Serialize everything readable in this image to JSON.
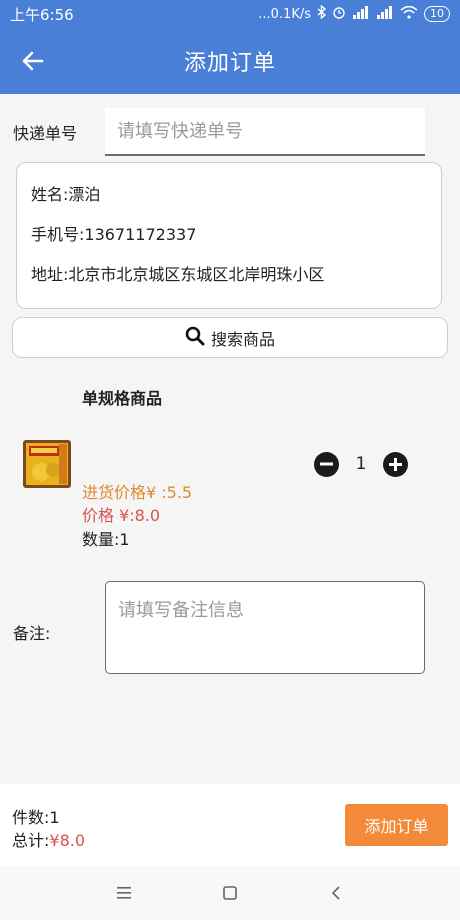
{
  "status_bar": {
    "time": "上午6:56",
    "network_speed": "...0.1K/s",
    "battery": "10"
  },
  "app_bar": {
    "title": "添加订单",
    "back_icon": "arrow-left-icon"
  },
  "express": {
    "label": "快递单号",
    "placeholder": "请填写快递单号",
    "value": ""
  },
  "address_card": {
    "name": "姓名:漂泊",
    "phone": "手机号:13671172337",
    "address": "地址:北京市北京城区东城区北岸明珠小区"
  },
  "search_button": {
    "label": "搜索商品",
    "icon": "search-icon"
  },
  "product_section": {
    "title": "单规格商品",
    "item": {
      "purchase_price": "进货价格¥ :5.5",
      "price": "价格 ¥:8.0",
      "quantity_label": "数量:1",
      "stepper_value": "1",
      "thumbnail": "product-thumbnail"
    }
  },
  "note": {
    "label": "备注:",
    "placeholder": "请填写备注信息",
    "value": ""
  },
  "footer": {
    "count": "件数:1",
    "total_label": "总计:",
    "total_value": "¥8.0",
    "submit_label": "添加订单"
  },
  "colors": {
    "app_bar": "#4a7fd8",
    "purchase_price": "#e08a2c",
    "price": "#d9534f",
    "submit": "#f28a3a"
  },
  "nav_bar": {
    "icons": [
      "menu-icon",
      "home-icon",
      "back-icon"
    ]
  }
}
